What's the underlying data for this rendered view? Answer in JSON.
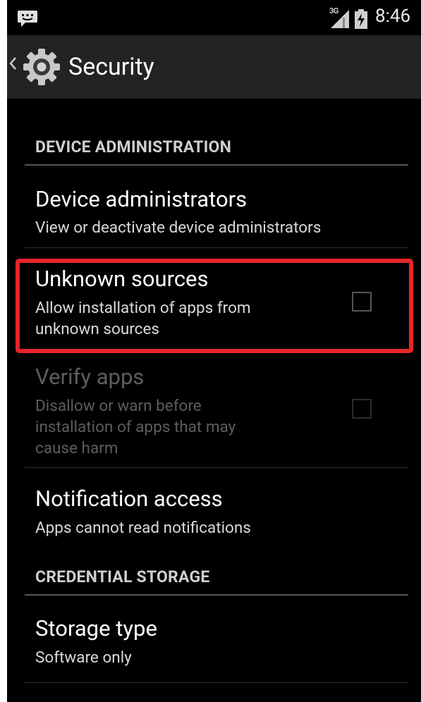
{
  "status_bar": {
    "network": "3G",
    "time": "8:46",
    "icons": [
      "notification-message-icon",
      "signal-icon",
      "battery-charging-icon"
    ]
  },
  "action_bar": {
    "title": "Security",
    "icons": [
      "back-chevron-icon",
      "settings-gear-icon"
    ]
  },
  "sections": [
    {
      "header": "DEVICE ADMINISTRATION",
      "items": [
        {
          "title": "Device administrators",
          "summary": "View or deactivate device administrators"
        },
        {
          "title": "Unknown sources",
          "summary": "Allow installation of apps from\nunknown sources",
          "checked": false,
          "highlighted": true
        },
        {
          "title": "Verify apps",
          "summary": "Disallow or warn before\ninstallation of apps that may\ncause harm",
          "checked": false,
          "enabled": false
        },
        {
          "title": "Notification access",
          "summary": "Apps cannot read notifications"
        }
      ]
    },
    {
      "header": "CREDENTIAL STORAGE",
      "items": [
        {
          "title": "Storage type",
          "summary": "Software only"
        }
      ]
    }
  ],
  "colors": {
    "background": "#000000",
    "action_bar": "#232323",
    "highlight": "#e5252a",
    "text_primary": "#ffffff",
    "text_disabled": "#5d5d5d"
  }
}
